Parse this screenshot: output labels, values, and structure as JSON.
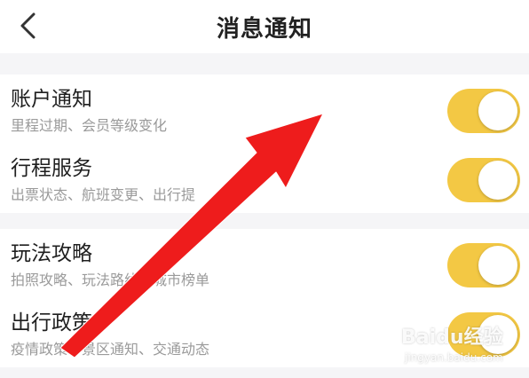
{
  "header": {
    "title": "消息通知",
    "back_icon": "chevron-left-icon"
  },
  "sections": [
    {
      "items": [
        {
          "title": "账户通知",
          "subtitle": "里程过期、会员等级变化",
          "enabled": true
        },
        {
          "title": "行程服务",
          "subtitle": "出票状态、航班变更、出行提",
          "enabled": true
        }
      ]
    },
    {
      "items": [
        {
          "title": "玩法攻略",
          "subtitle": "拍照攻略、玩法路线、城市榜单",
          "enabled": true
        },
        {
          "title": "出行政策",
          "subtitle": "疫情政策、景区通知、交通动态",
          "enabled": true
        }
      ]
    }
  ],
  "overlay": {
    "arrow_color": "#ee1c1c"
  },
  "watermark": {
    "brand": "Baidu经验",
    "url": "jingyan.baidu.com"
  },
  "colors": {
    "toggle_on": "#f3c844",
    "background": "#f5f5f7",
    "card": "#ffffff",
    "title_text": "#1f1f1f",
    "subtitle_text": "#9a9a9a"
  }
}
